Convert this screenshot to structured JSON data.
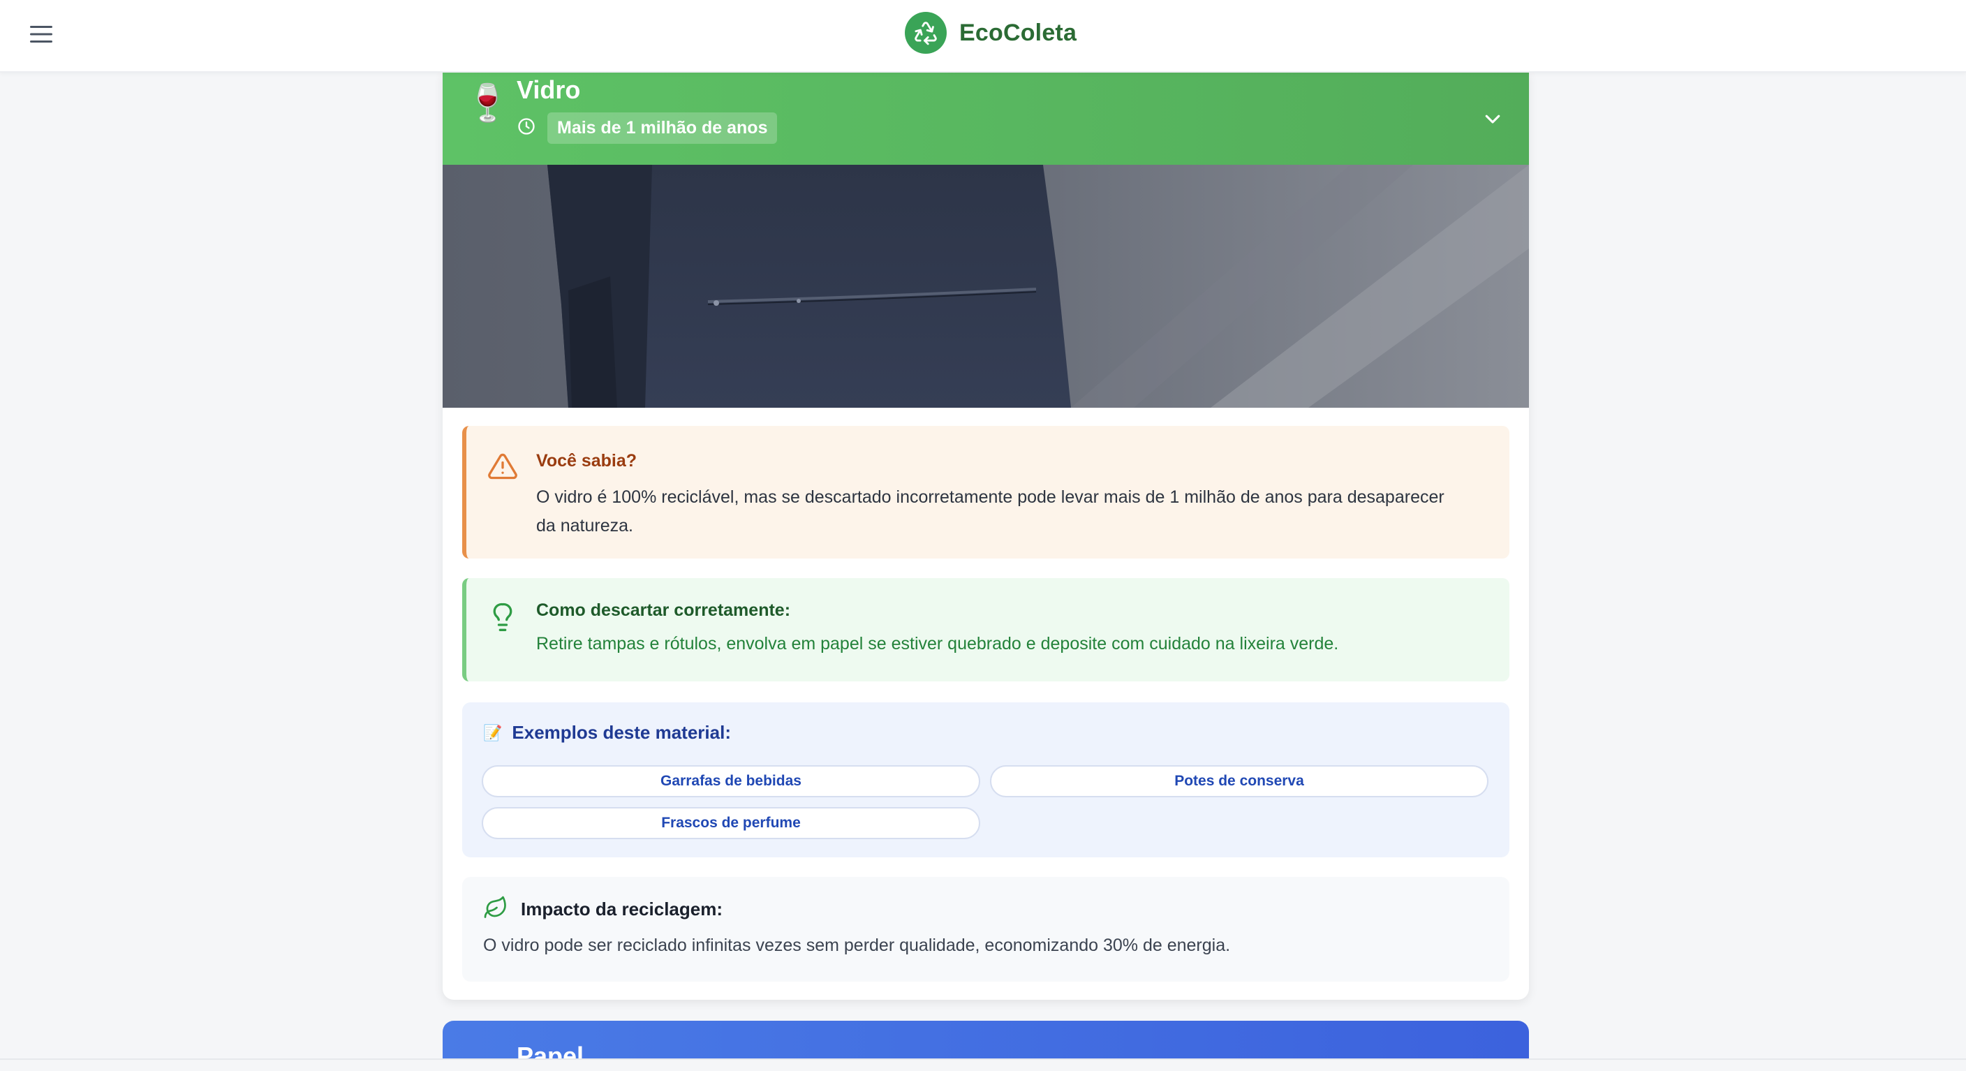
{
  "header": {
    "app_name": "EcoColeta",
    "menu_icon": "hamburger-menu-icon",
    "logo_icon": "recycle-icon",
    "brand_color": "#2b6b34"
  },
  "material": {
    "emoji": "🍷",
    "title": "Vidro",
    "decomposition_time": "Mais de 1 milhão de anos",
    "header_color": "#5ec266",
    "expand_icon": "chevron-down-icon"
  },
  "did_you_know": {
    "title": "Você sabia?",
    "text": "O vidro é 100% reciclável, mas se descartado incorretamente pode levar mais de 1 milhão de anos para desaparecer da natureza.",
    "icon": "warning-triangle-icon",
    "accent": "#e8904a"
  },
  "disposal": {
    "title": "Como descartar corretamente:",
    "text": "Retire tampas e rótulos, envolva em papel se estiver quebrado e deposite com cuidado na lixeira verde.",
    "icon": "lightbulb-icon",
    "accent": "#79cc82"
  },
  "examples": {
    "emoji": "📝",
    "title": "Exemplos deste material:",
    "items": [
      "Garrafas de bebidas",
      "Potes de conserva",
      "Frascos de perfume"
    ]
  },
  "impact": {
    "title": "Impacto da reciclagem:",
    "text": "O vidro pode ser reciclado infinitas vezes sem perder qualidade, economizando 30% de energia.",
    "icon": "leaf-icon"
  },
  "next_material": {
    "title": "Papel",
    "header_color": "#4a7be6"
  }
}
